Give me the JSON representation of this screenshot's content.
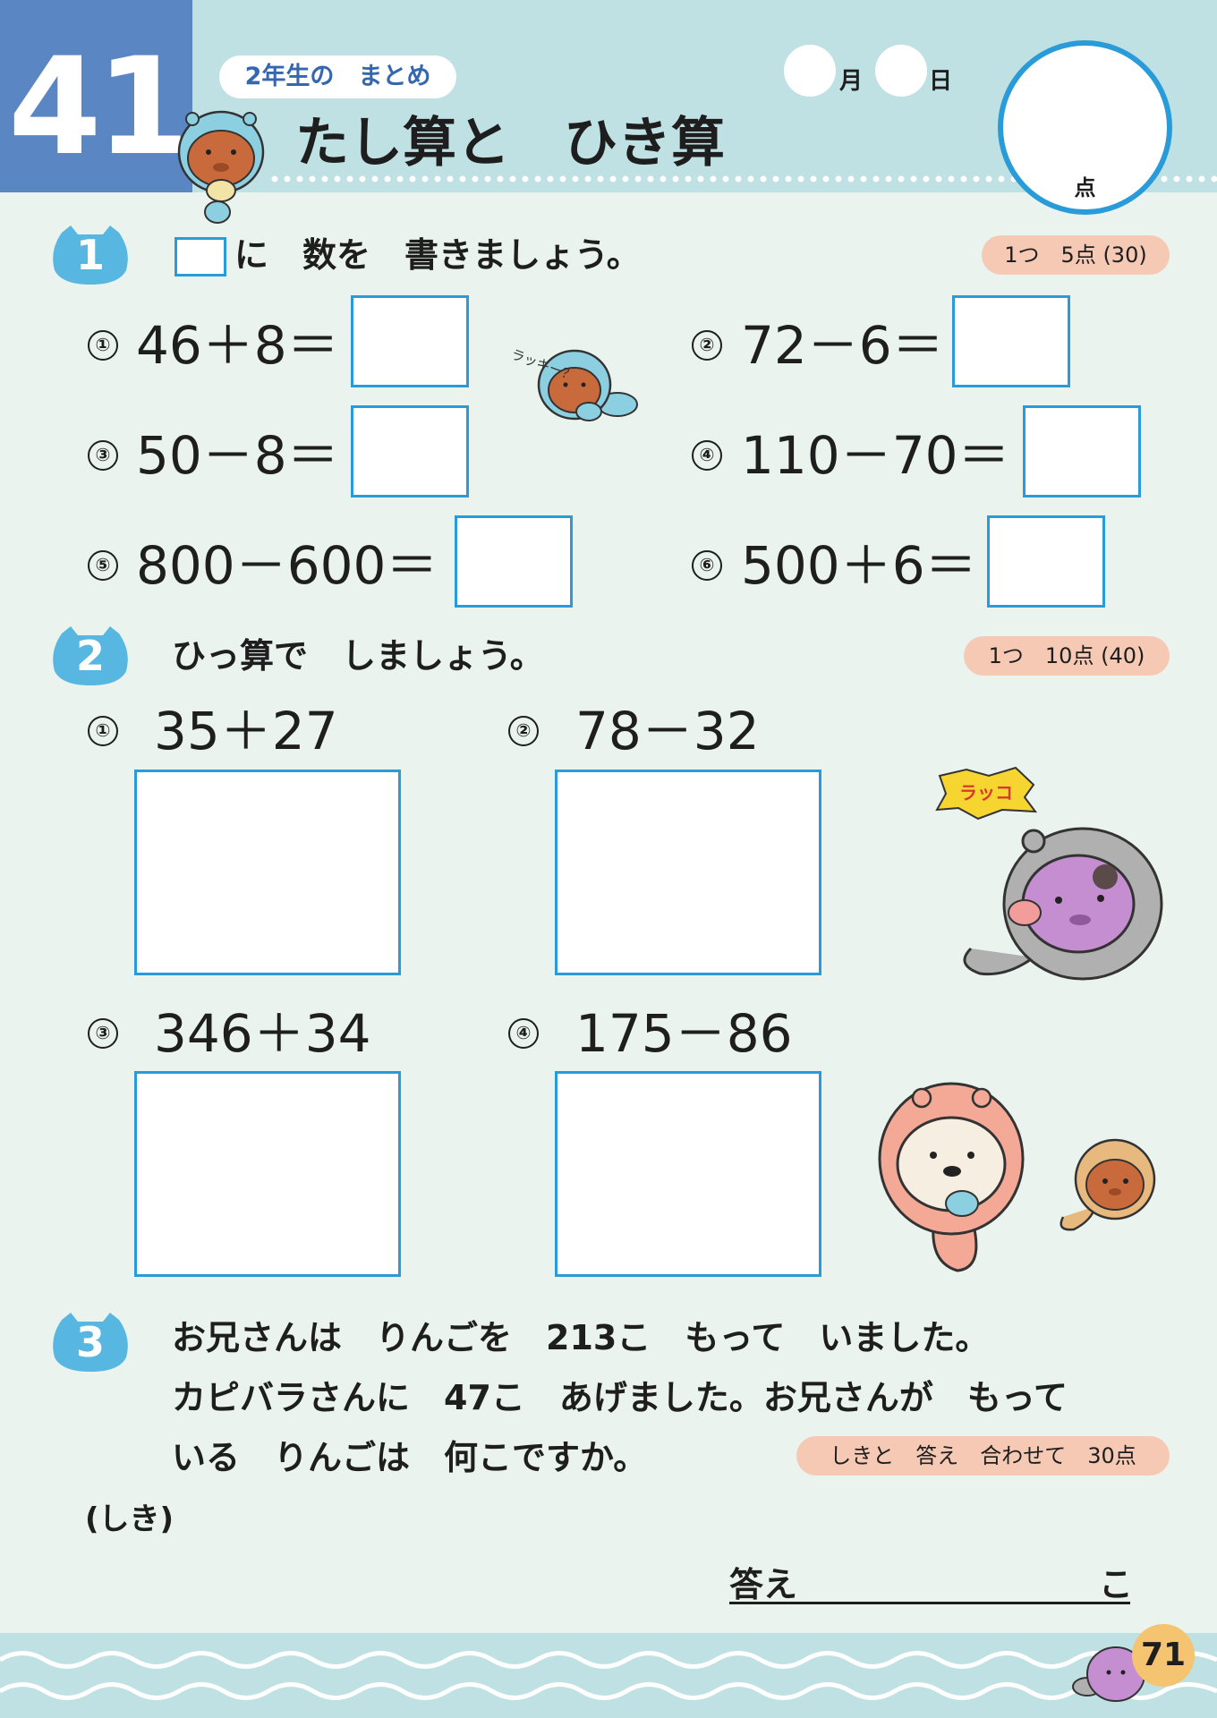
{
  "header": {
    "lesson_number": "41",
    "tag": "2年生の　まとめ",
    "title": "たし算と　ひき算",
    "month_label": "月",
    "day_label": "日",
    "score_unit": "点"
  },
  "problem1": {
    "badge": "1",
    "instruction_suffix": "に　数を　書きましょう。",
    "points": "1つ　5点 (30)",
    "items": [
      {
        "num": "①",
        "expr": "46＋8＝"
      },
      {
        "num": "②",
        "expr": "72－6＝"
      },
      {
        "num": "③",
        "expr": "50－8＝"
      },
      {
        "num": "④",
        "expr": "110－70＝"
      },
      {
        "num": "⑤",
        "expr": "800－600＝"
      },
      {
        "num": "⑥",
        "expr": "500＋6＝"
      }
    ]
  },
  "problem2": {
    "badge": "2",
    "instruction": "ひっ算で　しましょう。",
    "points": "1つ　10点 (40)",
    "items": [
      {
        "num": "①",
        "expr": "35＋27"
      },
      {
        "num": "②",
        "expr": "78－32"
      },
      {
        "num": "③",
        "expr": "346＋34"
      },
      {
        "num": "④",
        "expr": "175－86"
      }
    ]
  },
  "problem3": {
    "badge": "3",
    "lines": [
      "お兄さんは　りんごを　213こ　もって　いました。",
      "カピバラさんに　47こ　あげました。お兄さんが　もって",
      "いる　りんごは　何こですか。"
    ],
    "points": "しきと　答え　合わせて　30点",
    "shiki_label": "(しき)",
    "answer_label": "答え",
    "answer_unit": "こ"
  },
  "stickers": {
    "lucky": "ラッキー？",
    "rakko": "ラッコ"
  },
  "footer": {
    "page_number": "71"
  },
  "colors": {
    "accent_blue": "#2a9bd9",
    "header_blue": "#5b86c4",
    "band": "#bfe1e3",
    "page_bg": "#eaf3ee",
    "pill": "#f6c9b4"
  }
}
